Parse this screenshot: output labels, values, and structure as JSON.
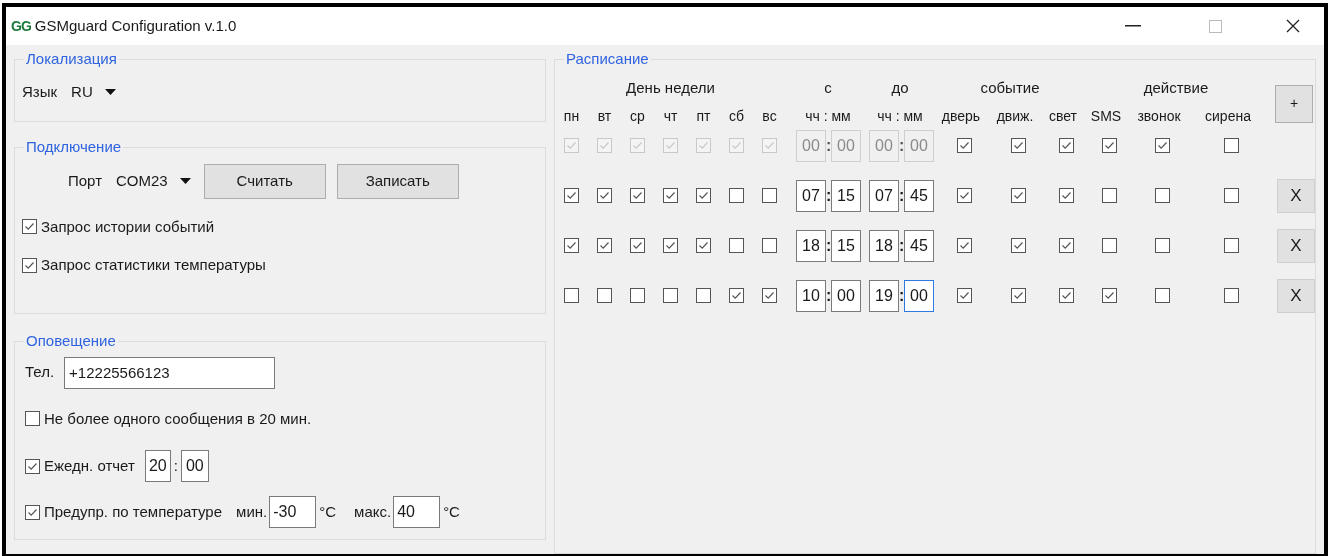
{
  "window": {
    "logo": "GG",
    "title": "GSMguard Configuration v.1.0"
  },
  "localization": {
    "title": "Локализация",
    "language_label": "Язык",
    "language": "RU"
  },
  "connection": {
    "title": "Подключение",
    "port_label": "Порт",
    "port": "COM23",
    "buttons": [
      "Считать",
      "Записать"
    ],
    "options": [
      {
        "label": "Запрос истории событий",
        "checked": true
      },
      {
        "label": "Запрос статистики температуры",
        "checked": true
      }
    ]
  },
  "notification": {
    "title": "Оповещение",
    "phone_label": "Тел.",
    "phone": "+12225566123",
    "limit": {
      "label": "Не более одного сообщения в 20 мин.",
      "checked": false
    },
    "daily_report": {
      "label": "Ежедн. отчет",
      "checked": true,
      "hours": "20",
      "separator": ":",
      "minutes": "00"
    },
    "temperature": {
      "label": "Предупр. по температуре",
      "checked": true,
      "min_label": "мин.",
      "min": "-30",
      "min_unit": "°C",
      "max_label": "макс.",
      "max": "40",
      "max_unit": "°C"
    }
  },
  "schedule": {
    "title": "Расписание",
    "day_header": "День недели",
    "from_header": "с",
    "to_header": "до",
    "event_header": "событие",
    "action_header": "действие",
    "days": [
      "пн",
      "вт",
      "ср",
      "чт",
      "пт",
      "сб",
      "вс"
    ],
    "time_headers": [
      "чч : мм",
      "чч : мм"
    ],
    "events": [
      "дверь",
      "движ.",
      "свет"
    ],
    "actions": [
      "SMS",
      "звонок",
      "сирена"
    ],
    "add_button": "+",
    "rows": [
      {
        "disabled": true,
        "days": [
          true,
          true,
          true,
          true,
          true,
          true,
          true
        ],
        "from_hours": "00",
        "from_sep": ":",
        "from_minutes": "00",
        "to_hours": "00",
        "to_sep": ":",
        "to_minutes": "00",
        "events": [
          true,
          true,
          true
        ],
        "actions": [
          true,
          true,
          false
        ],
        "to_minutes_focused": false
      },
      {
        "disabled": false,
        "days": [
          true,
          true,
          true,
          true,
          true,
          false,
          false
        ],
        "from_hours": "07",
        "from_sep": ":",
        "from_minutes": "15",
        "to_hours": "07",
        "to_sep": ":",
        "to_minutes": "45",
        "events": [
          true,
          true,
          true
        ],
        "actions": [
          false,
          false,
          false
        ],
        "delete_button": "X",
        "to_minutes_focused": false
      },
      {
        "disabled": false,
        "days": [
          true,
          true,
          true,
          true,
          true,
          false,
          false
        ],
        "from_hours": "18",
        "from_sep": ":",
        "from_minutes": "15",
        "to_hours": "18",
        "to_sep": ":",
        "to_minutes": "45",
        "events": [
          true,
          true,
          true
        ],
        "actions": [
          false,
          false,
          false
        ],
        "delete_button": "X",
        "to_minutes_focused": false
      },
      {
        "disabled": false,
        "days": [
          false,
          false,
          false,
          false,
          false,
          true,
          true
        ],
        "from_hours": "10",
        "from_sep": ":",
        "from_minutes": "00",
        "to_hours": "19",
        "to_sep": ":",
        "to_minutes": "00",
        "events": [
          true,
          true,
          true
        ],
        "actions": [
          true,
          false,
          false
        ],
        "delete_button": "X",
        "to_minutes_focused": true
      }
    ]
  }
}
